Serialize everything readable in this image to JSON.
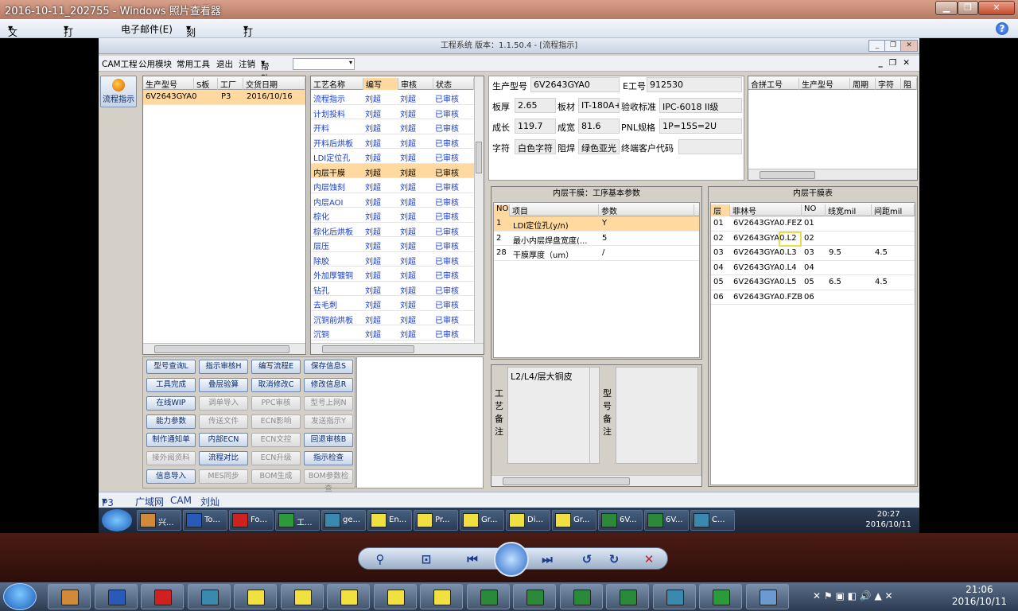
{
  "window": {
    "title": "2016-10-11_202755 - Windows 照片查看器"
  },
  "viewer_menu": [
    {
      "label": "文件(F)"
    },
    {
      "label": "打印(P)"
    },
    {
      "label": "电子邮件(E)"
    },
    {
      "label": "刻录(U)"
    },
    {
      "label": "打开(O)"
    }
  ],
  "app": {
    "title": "工程系统   版本：1.1.50.4 - [流程指示]",
    "menu": [
      "CAM工程",
      "公用模块",
      "常用工具",
      "退出",
      "注销",
      "帮助"
    ],
    "nav_button": "流程指示",
    "model_grid": {
      "headers": [
        "生产型号",
        "S板",
        "工厂",
        "交货日期"
      ],
      "rows": [
        [
          "6V2643GYA0",
          "",
          "P3",
          "2016/10/16"
        ]
      ]
    },
    "process_grid": {
      "headers": [
        "工艺名称",
        "编写",
        "审核",
        "状态"
      ],
      "rows": [
        [
          "流程指示",
          "刘超",
          "刘超",
          "已审核"
        ],
        [
          "计划投料",
          "刘超",
          "刘超",
          "已审核"
        ],
        [
          "开料",
          "刘超",
          "刘超",
          "已审核"
        ],
        [
          "开料后烘板",
          "刘超",
          "刘超",
          "已审核"
        ],
        [
          "LDI定位孔",
          "刘超",
          "刘超",
          "已审核"
        ],
        [
          "内层干膜",
          "刘超",
          "刘超",
          "已审核"
        ],
        [
          "内层蚀刻",
          "刘超",
          "刘超",
          "已审核"
        ],
        [
          "内层AOI",
          "刘超",
          "刘超",
          "已审核"
        ],
        [
          "棕化",
          "刘超",
          "刘超",
          "已审核"
        ],
        [
          "棕化后烘板",
          "刘超",
          "刘超",
          "已审核"
        ],
        [
          "层压",
          "刘超",
          "刘超",
          "已审核"
        ],
        [
          "除胶",
          "刘超",
          "刘超",
          "已审核"
        ],
        [
          "外加厚镀铜",
          "刘超",
          "刘超",
          "已审核"
        ],
        [
          "钻孔",
          "刘超",
          "刘超",
          "已审核"
        ],
        [
          "去毛刺",
          "刘超",
          "刘超",
          "已审核"
        ],
        [
          "沉铜前烘板",
          "刘超",
          "刘超",
          "已审核"
        ],
        [
          "沉铜",
          "刘超",
          "刘超",
          "已审核"
        ]
      ],
      "selected_index": 5
    },
    "info": {
      "model_label": "生产型号",
      "model": "6V2643GYA0",
      "e_label": "E工号",
      "e_no": "912530",
      "thick_label": "板厚",
      "thick": "2.65",
      "material_label": "板材",
      "material": "IT-180A+",
      "accept_label": "验收标准",
      "accept": "IPC-6018 II级",
      "len_label": "成长",
      "len": "119.7",
      "width_label": "成宽",
      "width": "81.6",
      "pnl_label": "PNL规格",
      "pnl": "1P=15S=2U",
      "char_label": "字符",
      "char": "白色字符",
      "mask_label": "阻焊",
      "mask": "绿色亚光",
      "client_label": "终端客户代码",
      "client": ""
    },
    "merge_grid": {
      "headers": [
        "合拼工号",
        "生产型号",
        "周期",
        "字符",
        "阻焊"
      ]
    },
    "params": {
      "title": "内层干膜：工序基本参数",
      "headers": [
        "NO",
        "项目",
        "参数"
      ],
      "rows": [
        [
          "1",
          "LDI定位孔(y/n)",
          "Y"
        ],
        [
          "2",
          "最小内层焊盘宽度(...",
          "5"
        ],
        [
          "28",
          "干膜厚度（um）",
          "/"
        ]
      ]
    },
    "layers": {
      "title": "内层干膜表",
      "headers": [
        "层",
        "菲林号",
        "NO",
        "线宽mil",
        "间距mil"
      ],
      "rows": [
        [
          "01",
          "6V2643GYA0.FEZ",
          "01",
          "",
          ""
        ],
        [
          "02",
          "6V2643GYA0.L2",
          "02",
          "",
          ""
        ],
        [
          "03",
          "6V2643GYA0.L3",
          "03",
          "9.5",
          "4.5"
        ],
        [
          "04",
          "6V2643GYA0.L4",
          "04",
          "",
          ""
        ],
        [
          "05",
          "6V2643GYA0.L5",
          "05",
          "6.5",
          "4.5"
        ],
        [
          "06",
          "6V2643GYA0.FZB",
          "06",
          "",
          ""
        ]
      ]
    },
    "buttons": [
      [
        "型号查询L",
        "指示审核H",
        "编写流程E",
        "保存信息S"
      ],
      [
        "工具完成",
        "叠层验算",
        "取消修改C",
        "修改信息R"
      ],
      [
        "在线WIP",
        "调单导入",
        "PPC审核",
        "型号上网N"
      ],
      [
        "能力参数",
        "传送文件",
        "ECN影响",
        "发送指示Y"
      ],
      [
        "制作通知单",
        "内部ECN",
        "ECN文控",
        "回退审核B"
      ],
      [
        "接外阅资料",
        "流程对比",
        "ECN升级",
        "指示检查"
      ],
      [
        "信息导入",
        "MES同步",
        "BOM生成",
        "BOM参数检查"
      ]
    ],
    "disabled_buttons": [
      "调单导入",
      "PPC审核",
      "型号上网N",
      "传送文件",
      "ECN影响",
      "发送指示Y",
      "ECN文控",
      "接外阅资料",
      "ECN升级",
      "MES同步",
      "BOM生成",
      "BOM参数检查"
    ],
    "remark": {
      "side_label": "工\n艺\n备\n注",
      "text": "L2/L4/层大铜皮",
      "model_label": "型\n号\n备\n注"
    },
    "status": {
      "factory": "P3",
      "net": "广域网",
      "dept": "CAM",
      "user": "刘灿"
    }
  },
  "inner_taskbar": {
    "items": [
      "兴...",
      "To...",
      "Fo...",
      "工...",
      "ge...",
      "En...",
      "Pr...",
      "Gr...",
      "Di...",
      "Gr...",
      "6V...",
      "6V...",
      "C..."
    ],
    "time": "20:27",
    "date": "2016/10/11"
  },
  "taskbar": {
    "time": "21:06",
    "date": "2016/10/11"
  }
}
